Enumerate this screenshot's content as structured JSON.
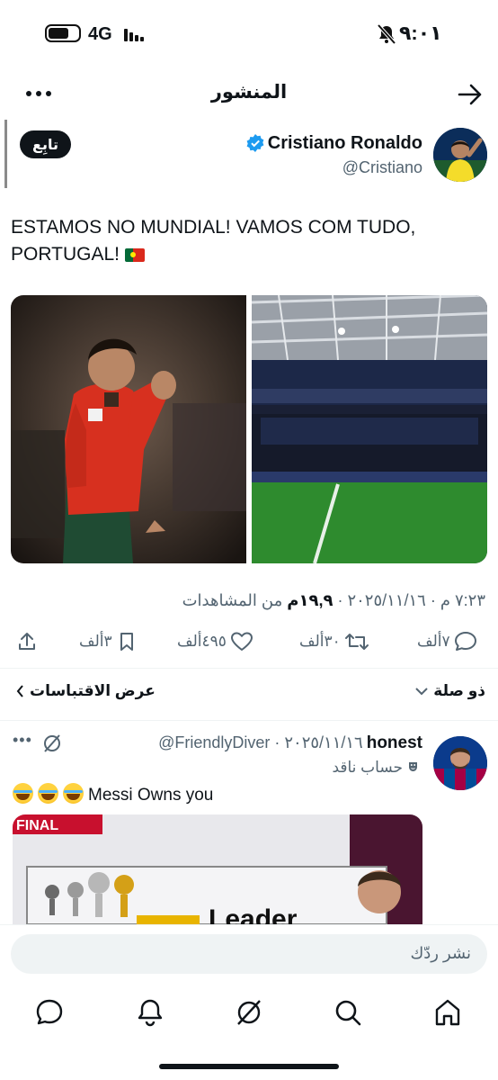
{
  "status_bar": {
    "time": "٩:٠١",
    "network": "4G"
  },
  "header": {
    "title": "المنشور"
  },
  "post": {
    "author_name": "Cristiano Ronaldo",
    "author_handle": "@Cristiano",
    "follow_label": "تابِع",
    "text": "ESTAMOS NO MUNDIAL! VAMOS COM TUDO, PORTUGAL!",
    "timestamp": "٧:٢٣ م · ٢٠٢٥/١١/١٦ ·",
    "views_count": "١٩,٩م",
    "views_label": "من المشاهدات",
    "replies": "٧ألف",
    "reposts": "٣٠ألف",
    "likes": "٤٩٥ألف",
    "bookmarks": "٣ألف"
  },
  "sort": {
    "label": "ذو صلة",
    "quotes_link": "عرض الاقتباسات"
  },
  "reply": {
    "name": "honest",
    "handle_date": "@FriendlyDiver · ٢٠٢٥/١١/١٦",
    "label": "حساب ناقد",
    "text": "Messi Owns you",
    "media_caption": "FINAL",
    "media_text": "Leader"
  },
  "compose": {
    "placeholder": "نشر ردّك"
  },
  "tabs": [
    "home",
    "search",
    "grok",
    "notifications",
    "messages"
  ],
  "colors": {
    "verified": "#1d9bf0",
    "text": "#0f1419",
    "muted": "#536471",
    "jersey": "#d7301f",
    "pitch": "#2e8b2e"
  }
}
